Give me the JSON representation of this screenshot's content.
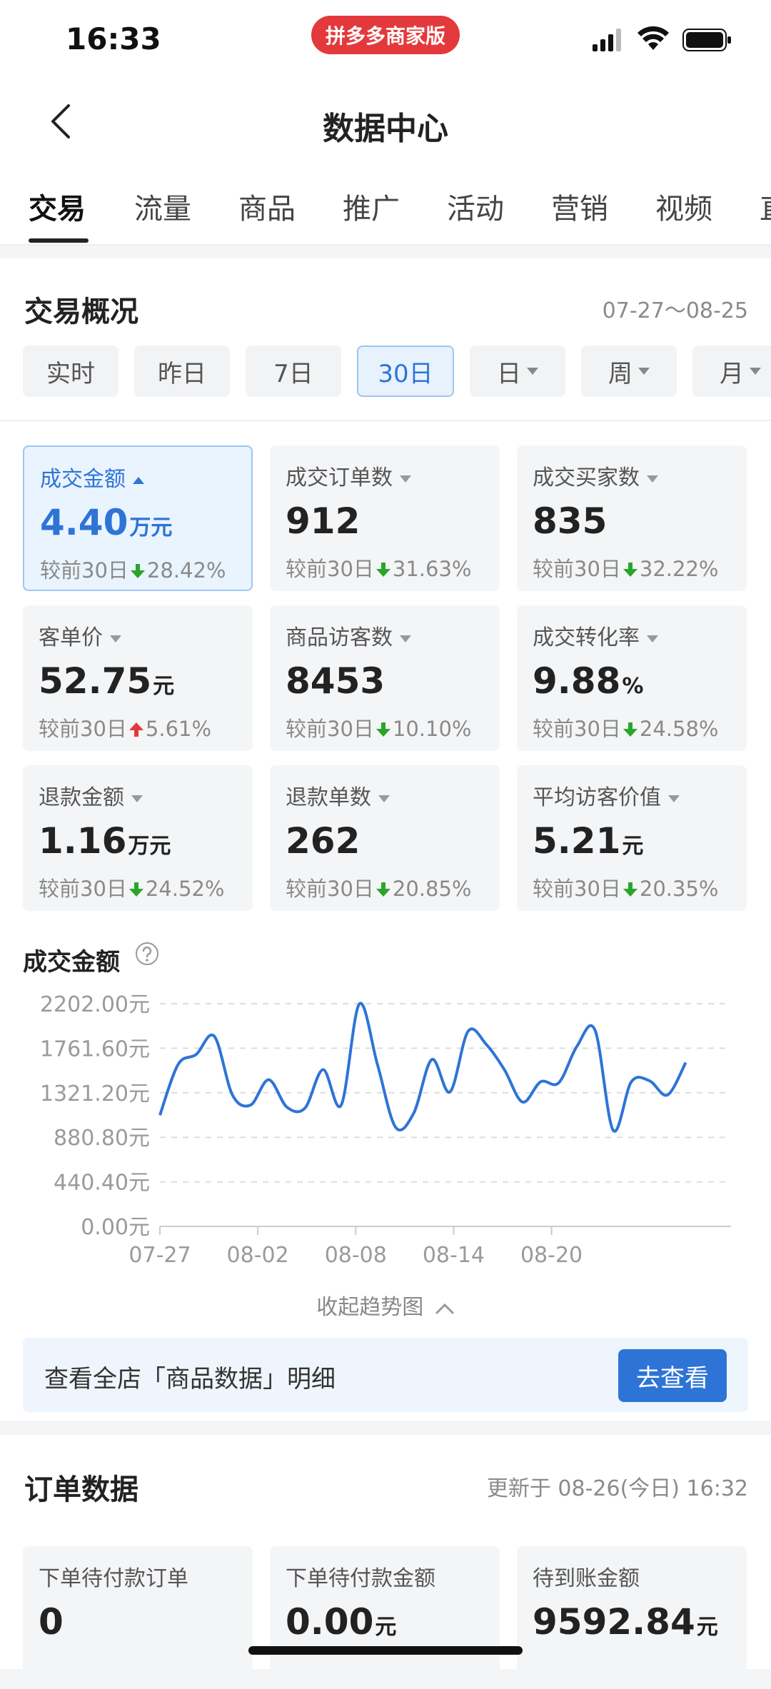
{
  "status_bar": {
    "time": "16:33",
    "app_badge": "拼多多商家版"
  },
  "nav": {
    "title": "数据中心"
  },
  "tabs": [
    "交易",
    "流量",
    "商品",
    "推广",
    "活动",
    "营销",
    "视频",
    "直"
  ],
  "overview": {
    "title": "交易概况",
    "date_range": "07-27～08-25",
    "periods": [
      "实时",
      "昨日",
      "7日",
      "30日",
      "日",
      "周",
      "月"
    ],
    "active_period": "30日"
  },
  "metrics": [
    {
      "label": "成交金额",
      "value": "4.40",
      "unit": "万元",
      "compare_prefix": "较前30日",
      "trend": "down",
      "change": "28.42%",
      "active": true
    },
    {
      "label": "成交订单数",
      "value": "912",
      "unit": "",
      "compare_prefix": "较前30日",
      "trend": "down",
      "change": "31.63%"
    },
    {
      "label": "成交买家数",
      "value": "835",
      "unit": "",
      "compare_prefix": "较前30日",
      "trend": "down",
      "change": "32.22%"
    },
    {
      "label": "客单价",
      "value": "52.75",
      "unit": "元",
      "compare_prefix": "较前30日",
      "trend": "up",
      "change": "5.61%"
    },
    {
      "label": "商品访客数",
      "value": "8453",
      "unit": "",
      "compare_prefix": "较前30日",
      "trend": "down",
      "change": "10.10%"
    },
    {
      "label": "成交转化率",
      "value": "9.88",
      "unit": "%",
      "compare_prefix": "较前30日",
      "trend": "down",
      "change": "24.58%"
    },
    {
      "label": "退款金额",
      "value": "1.16",
      "unit": "万元",
      "compare_prefix": "较前30日",
      "trend": "down",
      "change": "24.52%"
    },
    {
      "label": "退款单数",
      "value": "262",
      "unit": "",
      "compare_prefix": "较前30日",
      "trend": "down",
      "change": "20.85%"
    },
    {
      "label": "平均访客价值",
      "value": "5.21",
      "unit": "元",
      "compare_prefix": "较前30日",
      "trend": "down",
      "change": "20.35%"
    }
  ],
  "colors": {
    "accent": "#2e74d6",
    "down": "#2aa52a",
    "up": "#e4393c",
    "badge": "#e4393c"
  },
  "chart_section": {
    "title": "成交金额",
    "collapse_label": "收起趋势图"
  },
  "chart_data": {
    "type": "line",
    "title": "成交金额",
    "x": [
      "07-27",
      "07-28",
      "07-29",
      "07-30",
      "07-31",
      "08-01",
      "08-02",
      "08-03",
      "08-04",
      "08-05",
      "08-06",
      "08-07",
      "08-08",
      "08-09",
      "08-10",
      "08-11",
      "08-12",
      "08-13",
      "08-14",
      "08-15",
      "08-16",
      "08-17",
      "08-18",
      "08-19",
      "08-20",
      "08-21",
      "08-22",
      "08-23",
      "08-24",
      "08-25"
    ],
    "x_ticks": [
      "07-27",
      "08-02",
      "08-08",
      "08-14",
      "08-20"
    ],
    "y_ticks": [
      "0.00元",
      "440.40元",
      "880.80元",
      "1321.20元",
      "1761.60元",
      "2202.00元"
    ],
    "ylim": [
      0,
      2202.0
    ],
    "series": [
      {
        "values": [
          1100,
          1600,
          1700,
          1880,
          1300,
          1200,
          1450,
          1180,
          1170,
          1550,
          1200,
          2200,
          1600,
          980,
          1120,
          1650,
          1330,
          1930,
          1800,
          1550,
          1230,
          1430,
          1420,
          1780,
          1940,
          950,
          1430,
          1440,
          1300,
          1620
        ]
      }
    ],
    "grid": true
  },
  "banner": {
    "text": "查看全店「商品数据」明细",
    "button": "去查看"
  },
  "orders": {
    "title": "订单数据",
    "updated": "更新于 08-26(今日) 16:32",
    "cards": [
      {
        "label": "下单待付款订单",
        "value": "0",
        "unit": ""
      },
      {
        "label": "下单待付款金额",
        "value": "0.00",
        "unit": "元"
      },
      {
        "label": "待到账金额",
        "value": "9592.84",
        "unit": "元"
      }
    ]
  }
}
